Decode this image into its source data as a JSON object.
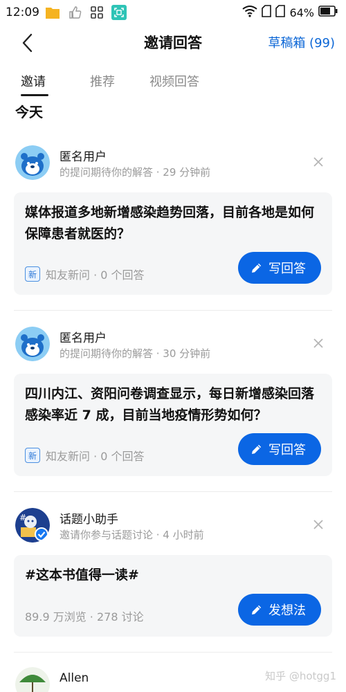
{
  "status_bar": {
    "time": "12:09",
    "battery": "64%"
  },
  "header": {
    "title": "邀请回答",
    "drafts_label": "草稿箱 (99)"
  },
  "tabs": [
    {
      "label": "邀请",
      "active": true
    },
    {
      "label": "推荐",
      "active": false
    },
    {
      "label": "视频回答",
      "active": false
    }
  ],
  "section_title": "今天",
  "items": [
    {
      "user": "匿名用户",
      "meta": "的提问期待你的解答 · 29 分钟前",
      "question": "媒体报道多地新增感染趋势回落，目前各地是如何保障患者就医的？",
      "badge": "新",
      "footer": "知友新问 · 0 个回答",
      "action": "写回答"
    },
    {
      "user": "匿名用户",
      "meta": "的提问期待你的解答 · 30 分钟前",
      "question": "四川内江、资阳问卷调查显示，每日新增感染回落感染率近 7 成，目前当地疫情形势如何？",
      "badge": "新",
      "footer": "知友新问 · 0 个回答",
      "action": "写回答"
    },
    {
      "user": "话题小助手",
      "meta": "邀请你参与话题讨论 · 4 小时前",
      "question": "#这本书值得一读#",
      "footer": "89.9 万浏览 · 278 讨论",
      "action": "发想法"
    },
    {
      "user": "Allen"
    }
  ],
  "watermark": "知乎 @hotgg1",
  "colors": {
    "accent": "#0b66e4",
    "link": "#0b66d6",
    "card_bg": "#f5f6f7"
  }
}
